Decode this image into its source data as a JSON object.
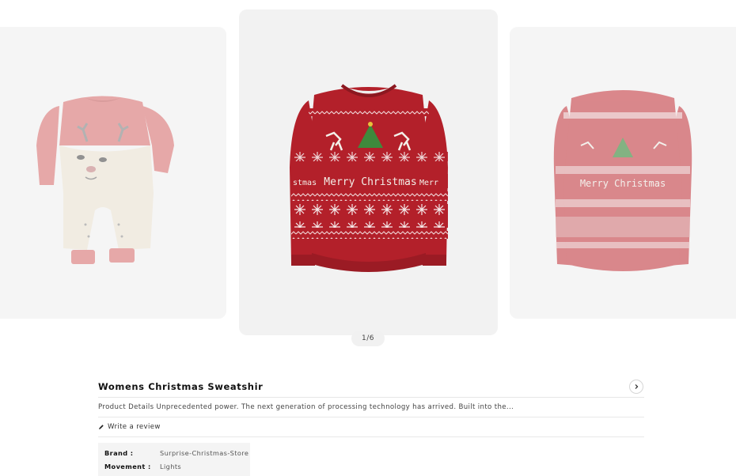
{
  "gallery": {
    "pager": "1/6",
    "sweater_text": "Merry Christmas",
    "sweater_text_left": "stmas",
    "sweater_text_right": "Merr",
    "colors": {
      "sweater_red": "#b3202a",
      "tree_green": "#3e8a3c",
      "romper_pink": "#de7a7a",
      "romper_cream": "#efe7d7"
    }
  },
  "product": {
    "title": "Womens Christmas Sweatshir",
    "description": "Product Details Unprecedented power. The next generation of processing technology has arrived. Built into the...",
    "review_label": "Write a review",
    "specs": [
      {
        "key": "Brand :",
        "value": "Surprise-Christmas-Store"
      },
      {
        "key": "Movement :",
        "value": "Lights"
      }
    ]
  }
}
